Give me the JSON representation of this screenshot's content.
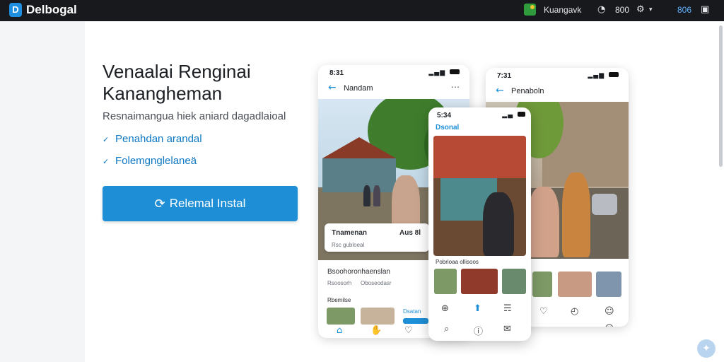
{
  "topbar": {
    "logo_letter": "D",
    "brand": "Delbogal",
    "user_name": "Kuangavk",
    "help_icon": "help-icon",
    "count": "800",
    "settings_icon": "settings-icon",
    "caret": "▾",
    "code": "806",
    "window_icon": "window-icon"
  },
  "hero": {
    "title": "Venaalai Renginai Kanangheman",
    "subtitle": "Resnaimangua hiek aniard dagadlaioal",
    "features": [
      "Penahdan arandal",
      "Folemgnglelaneä"
    ],
    "cta_label": "Relemal Instal",
    "colors": {
      "accent": "#1e8fd6",
      "topbar": "#17191d"
    }
  },
  "phone_left": {
    "time": "8:31",
    "title": "Nandam",
    "card_name": "Tnamenan",
    "card_price": "Aus 8l",
    "card_caption": "Rsc gubloeal",
    "section_title": "Bsoohoronhaenslan",
    "meta_a": "Rsoosorh",
    "meta_b": "Oboseodasr",
    "list_label": "Rbemilse",
    "chip": "Dsatan"
  },
  "phone_middle": {
    "time": "5:34",
    "title": "Dsonal",
    "caption": "Pobrioaa ollisoos"
  },
  "phone_right": {
    "time": "7:31",
    "title": "Penaboln"
  },
  "fab_icon": "assistant-icon"
}
